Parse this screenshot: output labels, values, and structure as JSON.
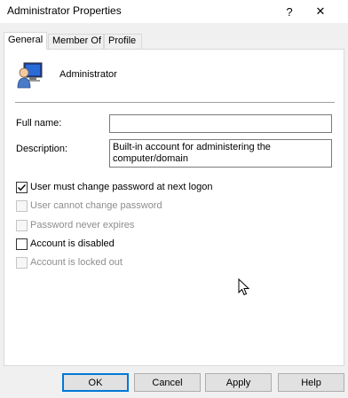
{
  "window": {
    "title": "Administrator Properties",
    "help_glyph": "?",
    "close_glyph": "✕"
  },
  "tabs": [
    {
      "label": "General",
      "active": true
    },
    {
      "label": "Member Of",
      "active": false
    },
    {
      "label": "Profile",
      "active": false
    }
  ],
  "general": {
    "user_name": "Administrator",
    "user_icon": "user-account-icon",
    "full_name_label": "Full name:",
    "full_name_value": "",
    "description_label": "Description:",
    "description_value": "Built-in account for administering the computer/domain",
    "checkboxes": [
      {
        "label": "User must change password at next logon",
        "checked": true,
        "enabled": true
      },
      {
        "label": "User cannot change password",
        "checked": false,
        "enabled": false
      },
      {
        "label": "Password never expires",
        "checked": false,
        "enabled": false
      },
      {
        "label": "Account is disabled",
        "checked": false,
        "enabled": true
      },
      {
        "label": "Account is locked out",
        "checked": false,
        "enabled": false
      }
    ]
  },
  "buttons": {
    "ok": "OK",
    "cancel": "Cancel",
    "apply": "Apply",
    "help": "Help"
  },
  "colors": {
    "accent": "#0078d7",
    "dialog_bg": "#f0f0f0",
    "disabled_text": "#8d8d8d"
  }
}
